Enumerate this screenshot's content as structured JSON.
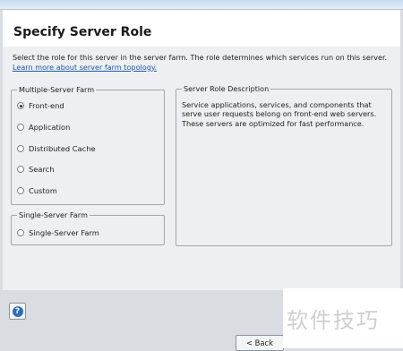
{
  "page": {
    "title": "Specify Server Role",
    "description": "Select the role for this server in the server farm. The role determines which services run on this server.",
    "learn_more_link": "Learn more about server farm topology."
  },
  "multi_server_farm": {
    "legend": "Multiple-Server Farm",
    "options": [
      {
        "label": "Front-end",
        "selected": true
      },
      {
        "label": "Application",
        "selected": false
      },
      {
        "label": "Distributed Cache",
        "selected": false
      },
      {
        "label": "Search",
        "selected": false
      },
      {
        "label": "Custom",
        "selected": false
      }
    ]
  },
  "single_server_farm": {
    "legend": "Single-Server Farm",
    "options": [
      {
        "label": "Single-Server Farm",
        "selected": false
      }
    ]
  },
  "role_description": {
    "legend": "Server Role Description",
    "text": "Service applications, services, and components that serve user requests belong on front-end web servers. These servers are optimized for fast performance."
  },
  "footer": {
    "help_icon": "question-mark-icon",
    "back_label": "< Back"
  },
  "watermark": "软件技巧"
}
